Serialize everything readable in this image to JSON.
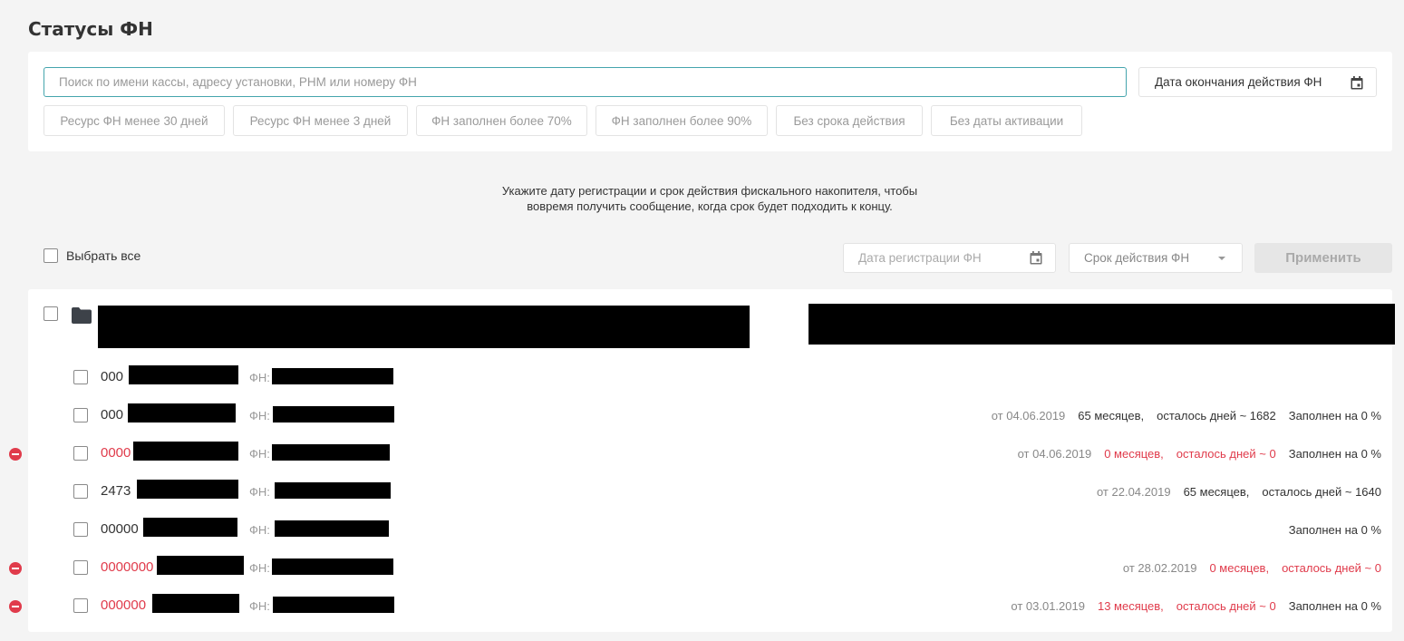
{
  "page": {
    "title": "Статусы ФН"
  },
  "search": {
    "placeholder": "Поиск по имени кассы, адресу установки, РНМ или номеру ФН",
    "value": ""
  },
  "end_date_filter": {
    "label": "Дата окончания действия ФН"
  },
  "chips": [
    "Ресурс ФН менее 30 дней",
    "Ресурс ФН менее 3 дней",
    "ФН заполнен более 70%",
    "ФН заполнен более 90%",
    "Без срока действия",
    "Без даты активации"
  ],
  "hint": {
    "line1": "Укажите дату регистрации и срок действия фискального накопителя, чтобы",
    "line2": "вовремя получить сообщение, когда срок будет подходить к концу."
  },
  "bulk": {
    "select_all": "Выбрать все",
    "reg_date_placeholder": "Дата регистрации ФН",
    "term_select": "Срок действия ФН",
    "apply": "Применить"
  },
  "fn_label": "ФН:",
  "rows": [
    {
      "name": "000",
      "error": false,
      "date": "",
      "months": "",
      "days": "",
      "filled": ""
    },
    {
      "name": "000",
      "error": false,
      "date": "от 04.06.2019",
      "months": "65 месяцев,",
      "days": "осталось дней ~ 1682",
      "filled": "Заполнен на 0 %"
    },
    {
      "name": "0000",
      "error": true,
      "date": "от 04.06.2019",
      "months": "0 месяцев,",
      "days": "осталось дней ~ 0",
      "filled": "Заполнен на 0 %"
    },
    {
      "name": "2473",
      "error": false,
      "date": "от 22.04.2019",
      "months": "65 месяцев,",
      "days": "осталось дней ~ 1640",
      "filled": ""
    },
    {
      "name": "00000",
      "error": false,
      "date": "",
      "months": "",
      "days": "",
      "filled": "Заполнен на 0 %"
    },
    {
      "name": "0000000",
      "error": true,
      "date": "от 28.02.2019",
      "months": "0 месяцев,",
      "days": "осталось дней ~ 0",
      "filled": ""
    },
    {
      "name": "000000",
      "error": true,
      "date": "от 03.01.2019",
      "months": "13 месяцев,",
      "days": "осталось дней ~ 0",
      "filled": "Заполнен на 0 %"
    }
  ],
  "colors": {
    "accent": "#45a5ad",
    "error": "#e03b4b",
    "background": "#f4f4f4"
  },
  "icons": {
    "date": "calendar-icon",
    "group": "folder-icon",
    "status": "error-minus-icon"
  }
}
